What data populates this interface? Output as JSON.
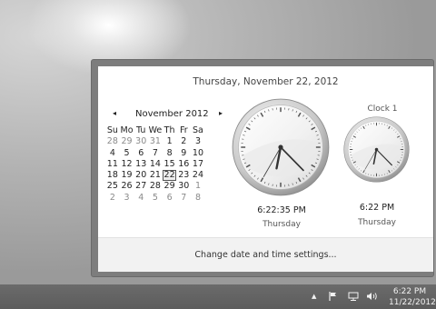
{
  "flyout": {
    "date_header": "Thursday, November 22, 2012",
    "calendar": {
      "month_label": "November 2012",
      "prev_glyph": "◂",
      "next_glyph": "▸",
      "weekdays": [
        "Su",
        "Mo",
        "Tu",
        "We",
        "Th",
        "Fr",
        "Sa"
      ],
      "weeks": [
        [
          "28",
          "29",
          "30",
          "31",
          "1",
          "2",
          "3"
        ],
        [
          "4",
          "5",
          "6",
          "7",
          "8",
          "9",
          "10"
        ],
        [
          "11",
          "12",
          "13",
          "14",
          "15",
          "16",
          "17"
        ],
        [
          "18",
          "19",
          "20",
          "21",
          "22",
          "23",
          "24"
        ],
        [
          "25",
          "26",
          "27",
          "28",
          "29",
          "30",
          "1"
        ],
        [
          "2",
          "3",
          "4",
          "5",
          "6",
          "7",
          "8"
        ]
      ],
      "today": "22"
    },
    "local_clock": {
      "time": "6:22:35 PM",
      "day": "Thursday",
      "hour": 6,
      "minute": 22,
      "second": 35
    },
    "clock1": {
      "name": "Clock 1",
      "time": "6:22 PM",
      "day": "Thursday",
      "hour": 6,
      "minute": 22,
      "second": 35
    },
    "footer_link": "Change date and time settings..."
  },
  "taskbar": {
    "icons": [
      "chevron-up-icon",
      "flag-icon",
      "network-icon",
      "speaker-icon"
    ],
    "time": "6:22 PM",
    "date": "11/22/2012"
  }
}
